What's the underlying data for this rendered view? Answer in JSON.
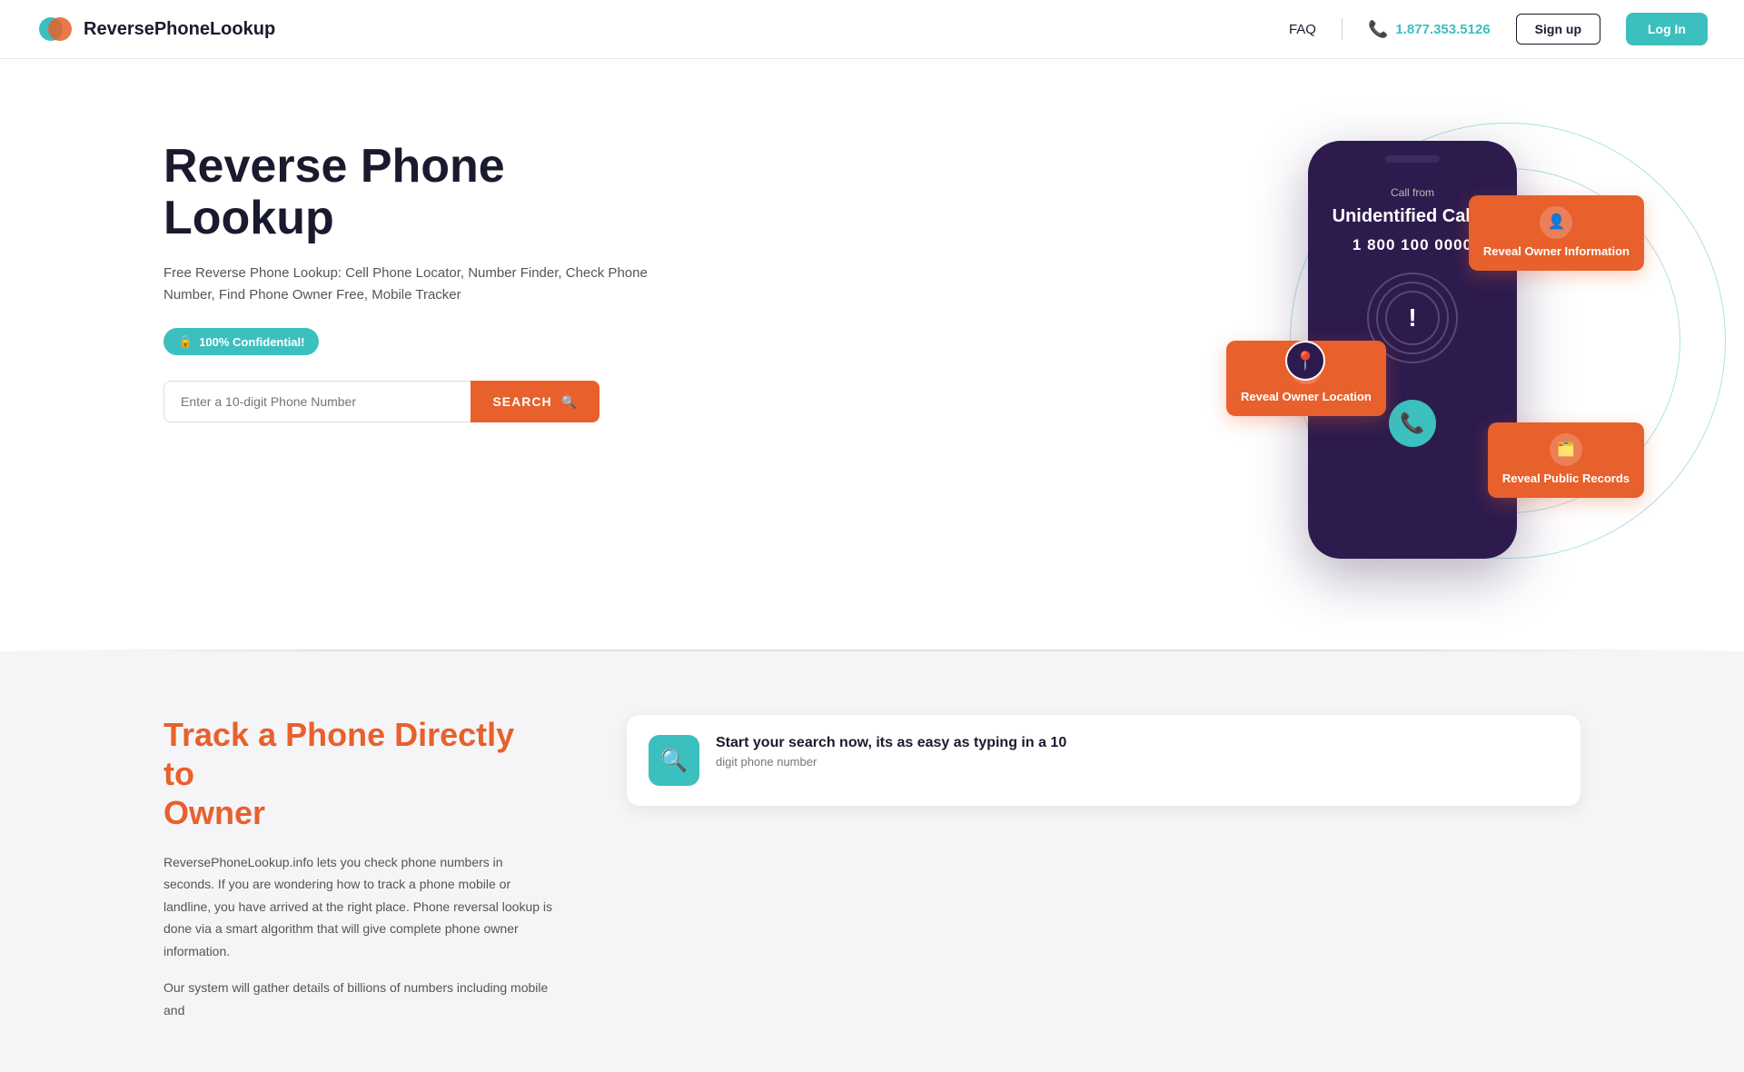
{
  "header": {
    "logo_text": "ReversePhoneLookup",
    "faq_label": "FAQ",
    "phone_number": "1.877.353.5126",
    "signup_label": "Sign up",
    "login_label": "Log In"
  },
  "hero": {
    "title": "Reverse Phone Lookup",
    "subtitle": "Free Reverse Phone Lookup: Cell Phone Locator, Number Finder, Check Phone Number, Find Phone Owner Free, Mobile Tracker",
    "badge": "100% Confidential!",
    "search_placeholder": "Enter a 10-digit Phone Number",
    "search_button": "SEARCH"
  },
  "phone_card": {
    "call_from_label": "Call from",
    "caller_name": "Unidentified Caller",
    "caller_number": "1 800 100 0000"
  },
  "float_cards": {
    "reveal_owner_info": "Reveal Owner Information",
    "reveal_location": "Reveal Owner Location",
    "reveal_public": "Reveal Public Records"
  },
  "lower": {
    "title_main": "Track a Phone Directly to",
    "title_accent": "Owner",
    "body1": "ReversePhoneLookup.info lets you check phone numbers in seconds. If you are wondering how to track a phone mobile or landline, you have arrived at the right place. Phone reversal lookup is done via a smart algorithm that will give complete phone owner information.",
    "body2": "Our system will gather details of billions of numbers including mobile and",
    "info_card": {
      "title": "Start your search now, its as easy as typing in a 10",
      "subtitle": "digit phone number"
    }
  }
}
